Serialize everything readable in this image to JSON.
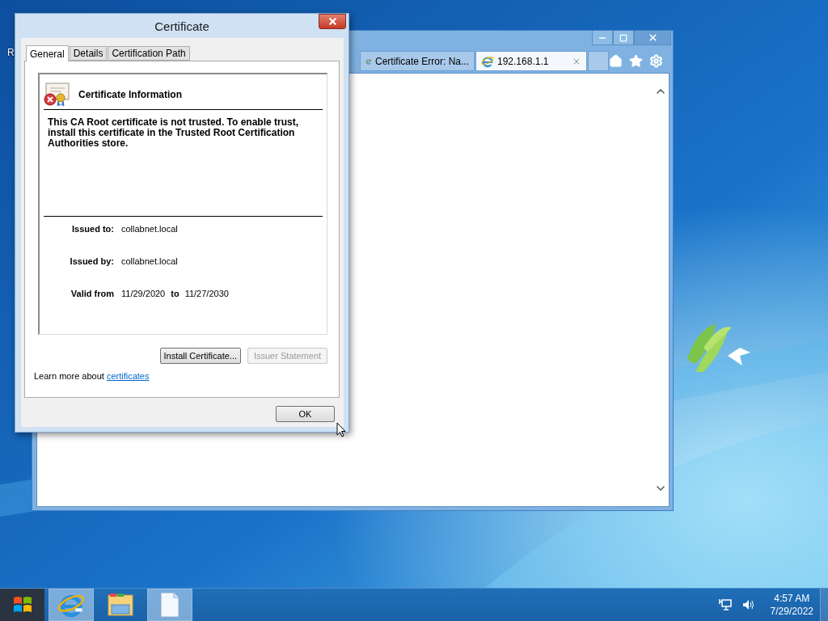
{
  "desktop": {
    "icons": [
      {
        "label": "R"
      }
    ]
  },
  "browser": {
    "tabs": [
      {
        "label": "Certificate Error: Na...",
        "selected": false
      },
      {
        "label": "192.168.1.1",
        "selected": true
      }
    ]
  },
  "dialog": {
    "title": "Certificate",
    "tabs": [
      {
        "label": "General",
        "selected": true
      },
      {
        "label": "Details",
        "selected": false
      },
      {
        "label": "Certification Path",
        "selected": false
      }
    ],
    "header": "Certificate Information",
    "message": "This CA Root certificate is not trusted. To enable trust, install this certificate in the Trusted Root Certification Authorities store.",
    "fields": [
      {
        "label": "Issued to:",
        "value": "collabnet.local"
      },
      {
        "label": "Issued by:",
        "value": "collabnet.local"
      }
    ],
    "validity": {
      "label": "Valid from",
      "from": "11/29/2020",
      "separator": "to",
      "to": "11/27/2030"
    },
    "buttons": [
      {
        "label": "Install Certificate...",
        "disabled": false
      },
      {
        "label": "Issuer Statement",
        "disabled": true
      }
    ],
    "learn_more": {
      "text": "Learn more about",
      "link": "certificates"
    },
    "ok": "OK"
  },
  "taskbar": {
    "apps": [
      {
        "kind": "browser",
        "highlighted": true
      },
      {
        "kind": "explorer",
        "highlighted": false
      },
      {
        "kind": "document",
        "highlighted": true
      }
    ],
    "clock": {
      "time": "4:57 AM",
      "date": "7/29/2022"
    }
  }
}
